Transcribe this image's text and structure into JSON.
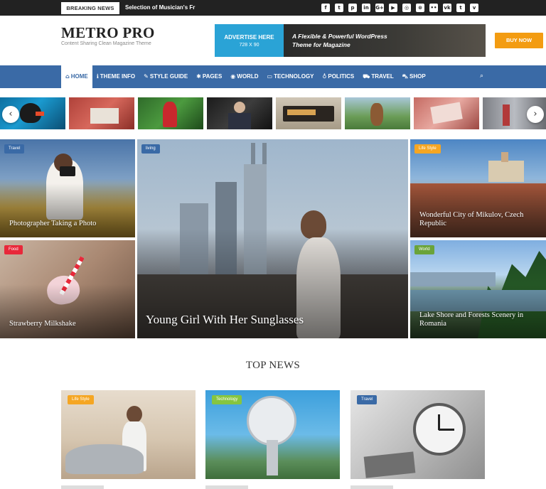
{
  "topbar": {
    "breaking_label": "BREAKING NEWS",
    "ticker_text": "Selection of Musician's Fr",
    "social_icons": [
      {
        "name": "facebook-icon",
        "glyph": "f"
      },
      {
        "name": "twitter-icon",
        "glyph": "t"
      },
      {
        "name": "pinterest-icon",
        "glyph": "p"
      },
      {
        "name": "linkedin-icon",
        "glyph": "in"
      },
      {
        "name": "google-plus-icon",
        "glyph": "G+"
      },
      {
        "name": "youtube-icon",
        "glyph": "▶"
      },
      {
        "name": "instagram-icon",
        "glyph": "◎"
      },
      {
        "name": "dribbble-icon",
        "glyph": "⊛"
      },
      {
        "name": "flickr-icon",
        "glyph": "••"
      },
      {
        "name": "vk-icon",
        "glyph": "vk"
      },
      {
        "name": "tumblr-icon",
        "glyph": "t"
      },
      {
        "name": "vimeo-icon",
        "glyph": "v"
      }
    ]
  },
  "header": {
    "logo": "METRO PRO",
    "tagline": "Content Sharing Clean Magazine Theme",
    "ad": {
      "title": "ADVERTISE HERE",
      "size": "728 X 90",
      "copy_line1": "A Flexible & Powerful WordPress",
      "copy_line2": "Theme for Magazine",
      "button": "BUY NOW"
    }
  },
  "nav": {
    "items": [
      {
        "label": "HOME",
        "icon": "⌂",
        "icon_name": "home-icon",
        "active": true
      },
      {
        "label": "THEME INFO",
        "icon": "ℹ",
        "icon_name": "info-icon",
        "active": false
      },
      {
        "label": "STYLE GUIDE",
        "icon": "✎",
        "icon_name": "pencil-icon",
        "active": false
      },
      {
        "label": "PAGES",
        "icon": "✱",
        "icon_name": "pages-icon",
        "active": false
      },
      {
        "label": "WORLD",
        "icon": "◉",
        "icon_name": "globe-icon",
        "active": false
      },
      {
        "label": "TECHNOLOGY",
        "icon": "▭",
        "icon_name": "monitor-icon",
        "active": false
      },
      {
        "label": "POLITICS",
        "icon": "♁",
        "icon_name": "microphone-icon",
        "active": false
      },
      {
        "label": "TRAVEL",
        "icon": "⛟",
        "icon_name": "car-icon",
        "active": false
      },
      {
        "label": "SHOP",
        "icon": "⛍",
        "icon_name": "cart-icon",
        "active": false
      }
    ],
    "search_icon": "⌕"
  },
  "carousel": {
    "prev": "‹",
    "next": "›"
  },
  "hero": {
    "tiles": [
      {
        "tag": "Travel",
        "caption": "Photographer Taking a Photo"
      },
      {
        "tag": "Food",
        "caption": "Strawberry Milkshake"
      },
      {
        "tag": "living",
        "caption": "Young Girl With Her Sunglasses"
      },
      {
        "tag": "Life Style",
        "caption": "Wonderful City of Mikulov, Czech Republic"
      },
      {
        "tag": "World",
        "caption": "Lake Shore and Forests Scenery in Romania"
      }
    ]
  },
  "top_news": {
    "title": "TOP NEWS",
    "cards": [
      {
        "tag": "Life Style"
      },
      {
        "tag": "Technology"
      },
      {
        "tag": "Travel"
      }
    ]
  },
  "colors": {
    "nav": "#3a6aa6",
    "ad_blue": "#2aa3d6",
    "buy": "#f39c12"
  }
}
